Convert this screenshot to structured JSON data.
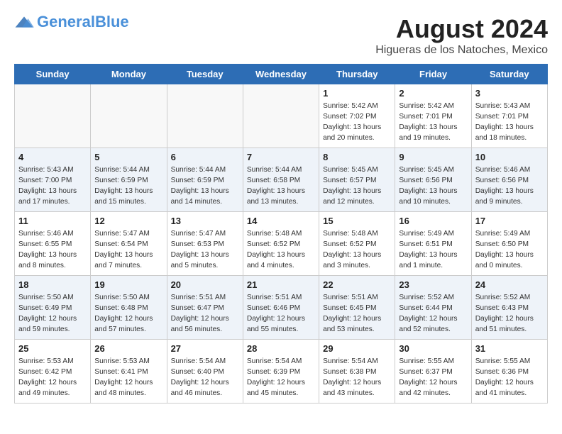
{
  "header": {
    "logo_general": "General",
    "logo_blue": "Blue",
    "month_title": "August 2024",
    "location": "Higueras de los Natoches, Mexico"
  },
  "weekdays": [
    "Sunday",
    "Monday",
    "Tuesday",
    "Wednesday",
    "Thursday",
    "Friday",
    "Saturday"
  ],
  "weeks": [
    [
      {
        "day": "",
        "info": ""
      },
      {
        "day": "",
        "info": ""
      },
      {
        "day": "",
        "info": ""
      },
      {
        "day": "",
        "info": ""
      },
      {
        "day": "1",
        "info": "Sunrise: 5:42 AM\nSunset: 7:02 PM\nDaylight: 13 hours\nand 20 minutes."
      },
      {
        "day": "2",
        "info": "Sunrise: 5:42 AM\nSunset: 7:01 PM\nDaylight: 13 hours\nand 19 minutes."
      },
      {
        "day": "3",
        "info": "Sunrise: 5:43 AM\nSunset: 7:01 PM\nDaylight: 13 hours\nand 18 minutes."
      }
    ],
    [
      {
        "day": "4",
        "info": "Sunrise: 5:43 AM\nSunset: 7:00 PM\nDaylight: 13 hours\nand 17 minutes."
      },
      {
        "day": "5",
        "info": "Sunrise: 5:44 AM\nSunset: 6:59 PM\nDaylight: 13 hours\nand 15 minutes."
      },
      {
        "day": "6",
        "info": "Sunrise: 5:44 AM\nSunset: 6:59 PM\nDaylight: 13 hours\nand 14 minutes."
      },
      {
        "day": "7",
        "info": "Sunrise: 5:44 AM\nSunset: 6:58 PM\nDaylight: 13 hours\nand 13 minutes."
      },
      {
        "day": "8",
        "info": "Sunrise: 5:45 AM\nSunset: 6:57 PM\nDaylight: 13 hours\nand 12 minutes."
      },
      {
        "day": "9",
        "info": "Sunrise: 5:45 AM\nSunset: 6:56 PM\nDaylight: 13 hours\nand 10 minutes."
      },
      {
        "day": "10",
        "info": "Sunrise: 5:46 AM\nSunset: 6:56 PM\nDaylight: 13 hours\nand 9 minutes."
      }
    ],
    [
      {
        "day": "11",
        "info": "Sunrise: 5:46 AM\nSunset: 6:55 PM\nDaylight: 13 hours\nand 8 minutes."
      },
      {
        "day": "12",
        "info": "Sunrise: 5:47 AM\nSunset: 6:54 PM\nDaylight: 13 hours\nand 7 minutes."
      },
      {
        "day": "13",
        "info": "Sunrise: 5:47 AM\nSunset: 6:53 PM\nDaylight: 13 hours\nand 5 minutes."
      },
      {
        "day": "14",
        "info": "Sunrise: 5:48 AM\nSunset: 6:52 PM\nDaylight: 13 hours\nand 4 minutes."
      },
      {
        "day": "15",
        "info": "Sunrise: 5:48 AM\nSunset: 6:52 PM\nDaylight: 13 hours\nand 3 minutes."
      },
      {
        "day": "16",
        "info": "Sunrise: 5:49 AM\nSunset: 6:51 PM\nDaylight: 13 hours\nand 1 minute."
      },
      {
        "day": "17",
        "info": "Sunrise: 5:49 AM\nSunset: 6:50 PM\nDaylight: 13 hours\nand 0 minutes."
      }
    ],
    [
      {
        "day": "18",
        "info": "Sunrise: 5:50 AM\nSunset: 6:49 PM\nDaylight: 12 hours\nand 59 minutes."
      },
      {
        "day": "19",
        "info": "Sunrise: 5:50 AM\nSunset: 6:48 PM\nDaylight: 12 hours\nand 57 minutes."
      },
      {
        "day": "20",
        "info": "Sunrise: 5:51 AM\nSunset: 6:47 PM\nDaylight: 12 hours\nand 56 minutes."
      },
      {
        "day": "21",
        "info": "Sunrise: 5:51 AM\nSunset: 6:46 PM\nDaylight: 12 hours\nand 55 minutes."
      },
      {
        "day": "22",
        "info": "Sunrise: 5:51 AM\nSunset: 6:45 PM\nDaylight: 12 hours\nand 53 minutes."
      },
      {
        "day": "23",
        "info": "Sunrise: 5:52 AM\nSunset: 6:44 PM\nDaylight: 12 hours\nand 52 minutes."
      },
      {
        "day": "24",
        "info": "Sunrise: 5:52 AM\nSunset: 6:43 PM\nDaylight: 12 hours\nand 51 minutes."
      }
    ],
    [
      {
        "day": "25",
        "info": "Sunrise: 5:53 AM\nSunset: 6:42 PM\nDaylight: 12 hours\nand 49 minutes."
      },
      {
        "day": "26",
        "info": "Sunrise: 5:53 AM\nSunset: 6:41 PM\nDaylight: 12 hours\nand 48 minutes."
      },
      {
        "day": "27",
        "info": "Sunrise: 5:54 AM\nSunset: 6:40 PM\nDaylight: 12 hours\nand 46 minutes."
      },
      {
        "day": "28",
        "info": "Sunrise: 5:54 AM\nSunset: 6:39 PM\nDaylight: 12 hours\nand 45 minutes."
      },
      {
        "day": "29",
        "info": "Sunrise: 5:54 AM\nSunset: 6:38 PM\nDaylight: 12 hours\nand 43 minutes."
      },
      {
        "day": "30",
        "info": "Sunrise: 5:55 AM\nSunset: 6:37 PM\nDaylight: 12 hours\nand 42 minutes."
      },
      {
        "day": "31",
        "info": "Sunrise: 5:55 AM\nSunset: 6:36 PM\nDaylight: 12 hours\nand 41 minutes."
      }
    ]
  ]
}
